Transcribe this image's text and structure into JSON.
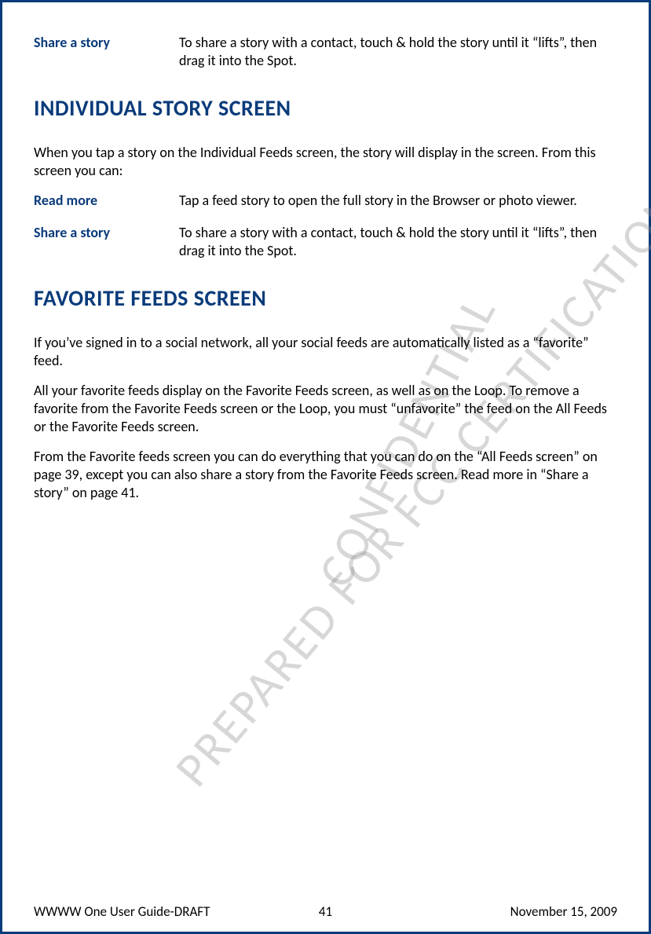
{
  "rows_top": [
    {
      "term": "Share a story",
      "desc": "To share a story with a contact, touch & hold the story until it “lifts”, then drag it into the Spot."
    }
  ],
  "heading1": "INDIVIDUAL STORY SCREEN",
  "intro1": "When you tap a story on the Individual Feeds screen, the story will display in the screen. From this screen you can:",
  "rows1": [
    {
      "term": "Read more",
      "desc": "Tap a feed story to open the full story in the Browser or photo viewer."
    },
    {
      "term": "Share a story",
      "desc": "To share a story with a contact, touch & hold the story until it “lifts”, then drag it into the Spot."
    }
  ],
  "heading2": "FAVORITE FEEDS SCREEN",
  "para1": "If you’ve signed in to a social network, all your social feeds are automatically listed as a “favorite” feed.",
  "para2": "All your favorite feeds display on the Favorite Feeds screen, as well as on the Loop. To remove a favorite from the Favorite Feeds screen or the Loop, you must “unfavorite” the feed on the All Feeds or the Favorite Feeds screen.",
  "para3": "From the Favorite feeds screen you can do everything that you can do on the “All Feeds screen” on page 39, except you can also share a story from the Favorite Feeds screen. Read more in “Share a story” on page 41.",
  "watermark1": "PREPARED FOR FCC CERTIFICATION",
  "watermark2": "CONFIDENTIAL",
  "footer_left": "WWWW One User Guide-DRAFT",
  "footer_center": "41",
  "footer_right": "November 15, 2009"
}
